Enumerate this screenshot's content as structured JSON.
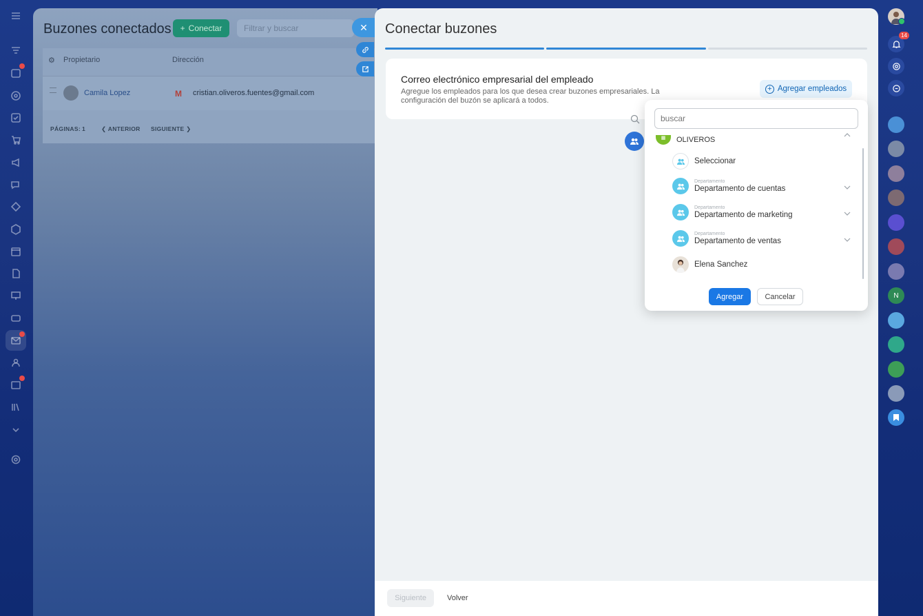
{
  "background_page": {
    "title": "Buzones conectados",
    "connect_label": "Conectar",
    "filter_placeholder": "Filtrar y buscar",
    "columns": [
      "Propietario",
      "Dirección"
    ],
    "rows": [
      {
        "owner": "Camila Lopez",
        "email": "cristian.oliveros.fuentes@gmail.com"
      }
    ],
    "pagination": {
      "pages_label": "PÁGINAS:",
      "page": "1",
      "prev": "ANTERIOR",
      "next": "SIGUIENTE"
    }
  },
  "panel": {
    "title": "Conectar buzones",
    "progress_steps_completed": 2,
    "progress_steps_total": 3,
    "card": {
      "title": "Correo electrónico empresarial del empleado",
      "description": "Agregue los empleados para los que desea crear buzones empresariales. La configuración del buzón se aplicará a todos.",
      "add_button": "Agregar empleados"
    },
    "footer": {
      "next": "Siguiente",
      "back": "Volver"
    }
  },
  "popup": {
    "search_placeholder": "buscar",
    "org_name": "OLIVEROS",
    "select_label": "Seleccionar",
    "departments": [
      {
        "kind": "Departamento",
        "name": "Departamento de cuentas"
      },
      {
        "kind": "Departamento",
        "name": "Departamento de marketing"
      },
      {
        "kind": "Departamento",
        "name": "Departamento de ventas"
      }
    ],
    "employee": "Elena Sanchez",
    "add_button": "Agregar",
    "cancel_button": "Cancelar"
  },
  "right_rail": {
    "notifications_count": "14"
  },
  "colors": {
    "accent": "#1a78e5",
    "progress": "#2f86d6",
    "department": "#5bc8ea",
    "org": "#7cbe2a"
  }
}
